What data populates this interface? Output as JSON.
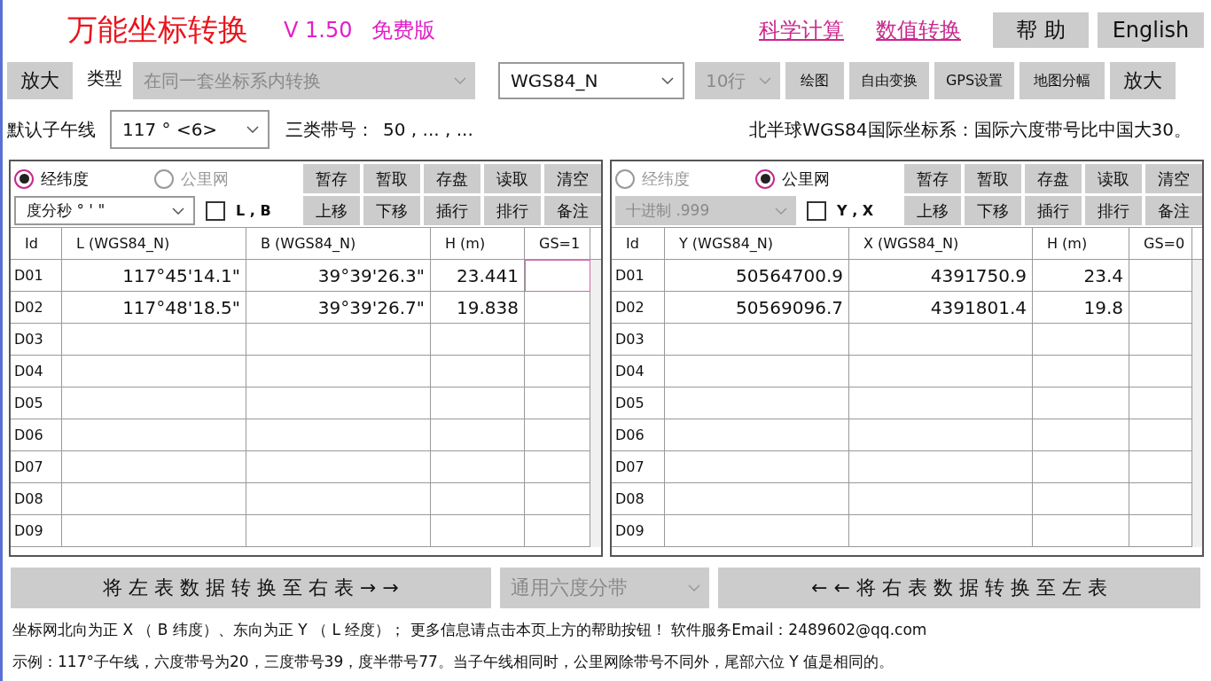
{
  "header": {
    "title": "万能坐标转换",
    "version": "V 1.50",
    "edition": "免费版",
    "links": [
      "科学计算",
      "数值转换"
    ],
    "buttons": [
      "帮 助",
      "English"
    ]
  },
  "toolbar": {
    "zoom_left": "放大",
    "type_label": "类型",
    "type_select": {
      "value": "在同一套坐标系内转换",
      "disabled": true
    },
    "system_select": {
      "value": "WGS84_N",
      "disabled": false
    },
    "rows_select": {
      "value": "10行",
      "disabled": true
    },
    "buttons": [
      "绘图",
      "自由变换",
      "GPS设置",
      "地图分幅"
    ],
    "zoom_right": "放大"
  },
  "meridian": {
    "label": "默认子午线",
    "select": "117 ° <6>",
    "zone_label": "三类带号：",
    "zone_value": "50 , ... , ...",
    "note": "北半球WGS84国际坐标系：国际六度带号比中国大30。"
  },
  "panels": [
    {
      "radios": [
        {
          "label": "经纬度",
          "selected": true
        },
        {
          "label": "公里网",
          "selected": false
        }
      ],
      "buttons": [
        [
          "暂存",
          "暂取",
          "存盘",
          "读取",
          "清空"
        ],
        [
          "上移",
          "下移",
          "插行",
          "排行",
          "备注"
        ]
      ],
      "format_select": {
        "value": "度分秒 ° ' \"",
        "disabled": false
      },
      "checkbox": {
        "label": "L , B",
        "checked": false
      },
      "columns": [
        "Id",
        "L (WGS84_N)",
        "B (WGS84_N)",
        "H (m)",
        "GS=1"
      ],
      "rows": [
        {
          "id": "D01",
          "cells": [
            "117°45'14.1\"",
            "39°39'26.3\"",
            "23.441",
            ""
          ]
        },
        {
          "id": "D02",
          "cells": [
            "117°48'18.5\"",
            "39°39'26.7\"",
            "19.838",
            ""
          ]
        },
        {
          "id": "D03",
          "cells": [
            "",
            "",
            "",
            ""
          ]
        },
        {
          "id": "D04",
          "cells": [
            "",
            "",
            "",
            ""
          ]
        },
        {
          "id": "D05",
          "cells": [
            "",
            "",
            "",
            ""
          ]
        },
        {
          "id": "D06",
          "cells": [
            "",
            "",
            "",
            ""
          ]
        },
        {
          "id": "D07",
          "cells": [
            "",
            "",
            "",
            ""
          ]
        },
        {
          "id": "D08",
          "cells": [
            "",
            "",
            "",
            ""
          ]
        },
        {
          "id": "D09",
          "cells": [
            "",
            "",
            "",
            ""
          ]
        }
      ]
    },
    {
      "radios": [
        {
          "label": "经纬度",
          "selected": false
        },
        {
          "label": "公里网",
          "selected": true
        }
      ],
      "buttons": [
        [
          "暂存",
          "暂取",
          "存盘",
          "读取",
          "清空"
        ],
        [
          "上移",
          "下移",
          "插行",
          "排行",
          "备注"
        ]
      ],
      "format_select": {
        "value": "十进制 .999",
        "disabled": true
      },
      "checkbox": {
        "label": "Y , X",
        "checked": false
      },
      "columns": [
        "Id",
        "Y (WGS84_N)",
        "X (WGS84_N)",
        "H (m)",
        "GS=0"
      ],
      "rows": [
        {
          "id": "D01",
          "cells": [
            "50564700.9",
            "4391750.9",
            "23.4",
            ""
          ]
        },
        {
          "id": "D02",
          "cells": [
            "50569096.7",
            "4391801.4",
            "19.8",
            ""
          ]
        },
        {
          "id": "D03",
          "cells": [
            "",
            "",
            "",
            ""
          ]
        },
        {
          "id": "D04",
          "cells": [
            "",
            "",
            "",
            ""
          ]
        },
        {
          "id": "D05",
          "cells": [
            "",
            "",
            "",
            ""
          ]
        },
        {
          "id": "D06",
          "cells": [
            "",
            "",
            "",
            ""
          ]
        },
        {
          "id": "D07",
          "cells": [
            "",
            "",
            "",
            ""
          ]
        },
        {
          "id": "D08",
          "cells": [
            "",
            "",
            "",
            ""
          ]
        },
        {
          "id": "D09",
          "cells": [
            "",
            "",
            "",
            ""
          ]
        }
      ]
    }
  ],
  "actions": {
    "to_right": "将 左 表 数 据 转 换 至 右 表  → →",
    "zone_select": {
      "value": "通用六度分带",
      "disabled": true
    },
    "to_left": "← ←  将 右 表 数 据 转 换 至 左 表"
  },
  "footer": [
    "坐标网北向为正 X （ B 纬度）、东向为正 Y （ L 经度）； 更多信息请点击本页上方的帮助按钮！ 软件服务Email：2489602@qq.com",
    "示例：117°子午线，六度带号为20，三度带号39，度半带号77。当子午线相同时，公里网除带号不同外，尾部六位 Y 值是相同的。"
  ]
}
